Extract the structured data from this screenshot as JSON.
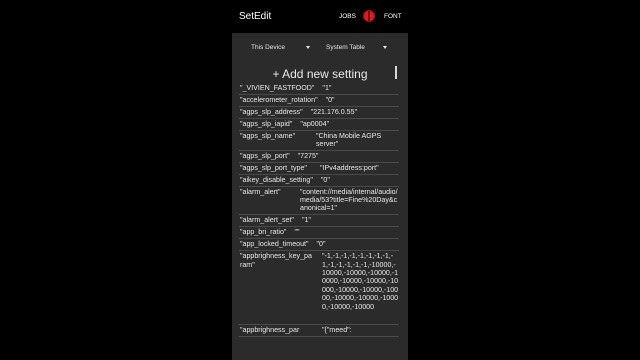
{
  "appbar": {
    "title": "SetEdit",
    "jobs_label": "JOBS",
    "bug_icon": "ladybug-icon",
    "font_label": "FONT"
  },
  "selectors": {
    "device": "This Device",
    "table": "System Table"
  },
  "add_setting_label": "+ Add new setting",
  "settings": [
    {
      "key": "\"_VIVIEN_FASTFOOD\"",
      "value": "\"1\""
    },
    {
      "key": "\"accelerometer_rotation\"",
      "value": "\"0\""
    },
    {
      "key": "\"agps_slp_address\"",
      "value": "\"221.176.0.55\""
    },
    {
      "key": "\"agps_slp_iapid\"",
      "value": "\"ap0004\""
    },
    {
      "key": "\"agps_slp_name\"",
      "value": "\"China Mobile AGPS server\""
    },
    {
      "key": "\"agps_slp_port\"",
      "value": "\"7275\""
    },
    {
      "key": "\"agps_slp_port_type\"",
      "value": "\"IPv4address:port\""
    },
    {
      "key": "\"aikey_disable_setting\"",
      "value": "\"0\""
    },
    {
      "key": "\"alarm_alert\"",
      "value": "\"content://media/internal/audio/media/53?title=Fine%20Day&canonical=1\""
    },
    {
      "key": "\"alarm_alert_set\"",
      "value": "\"1\""
    },
    {
      "key": "\"app_bri_ratio\"",
      "value": "\"\""
    },
    {
      "key": "\"app_locked_timeout\"",
      "value": "\"0\""
    },
    {
      "key": "\"appbrighness_key_param\"",
      "value": "\"-1,-1,-1,-1,-1,-1,-1,-1,-1,-1,-1,-1,-1,-1,-10000,-10000,-10000,-10000,-10000,-10000,-10000,-10000,-10000,-10000,-10000,-10000,-10000,-10000,-10000,-10000"
    },
    {
      "key": "\"appbrighness_par",
      "value": "\"{\"meed\":"
    }
  ],
  "colors": {
    "background": "#000000",
    "panel": "#2b2b2b",
    "text": "#e8e8e8",
    "divider": "#4a4a4a",
    "accent_icon": "#d62027"
  }
}
